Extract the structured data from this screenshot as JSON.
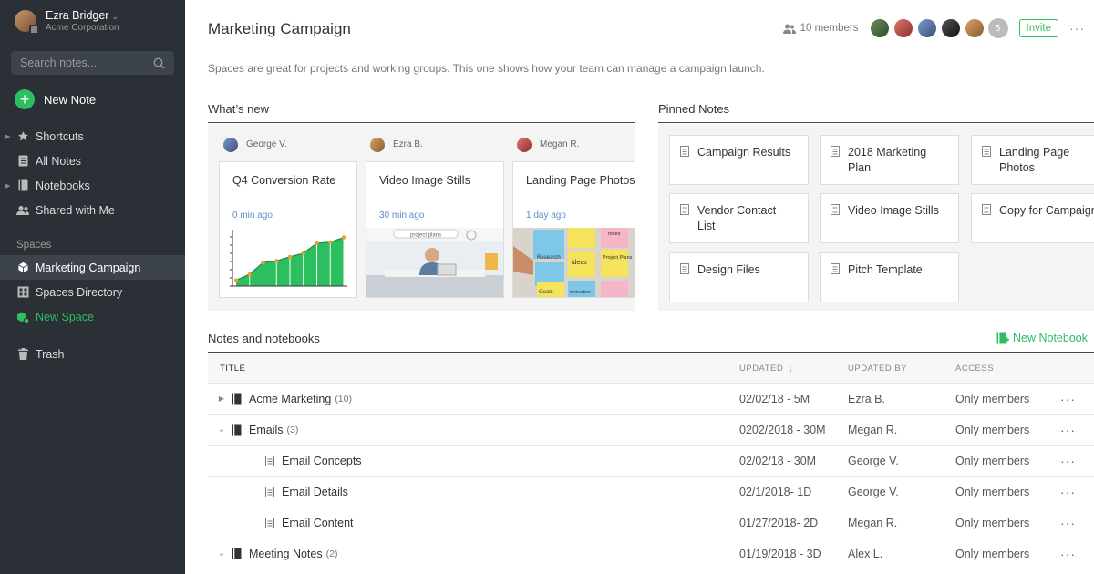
{
  "user": {
    "name": "Ezra Bridger",
    "org": "Acme Corporation"
  },
  "search": {
    "placeholder": "Search notes..."
  },
  "new_note": "New Note",
  "nav": {
    "shortcuts": "Shortcuts",
    "all_notes": "All Notes",
    "notebooks": "Notebooks",
    "shared": "Shared with Me"
  },
  "spaces": {
    "label": "Spaces",
    "campaign": "Marketing Campaign",
    "directory": "Spaces Directory",
    "new_space": "New Space"
  },
  "trash": "Trash",
  "colors": {
    "accent": "#2dbe60",
    "sidebar": "#2b3036",
    "link": "#5b8fc9"
  },
  "header": {
    "title": "Marketing Campaign",
    "members": "10 members",
    "extra_members": "5",
    "invite": "Invite",
    "description": "Spaces are great for projects and working groups. This one shows how your team can manage a campaign launch."
  },
  "whats_new": {
    "heading": "What’s new",
    "cards": [
      {
        "author": "George V.",
        "title": "Q4 Conversion Rate",
        "time": "0 min ago"
      },
      {
        "author": "Ezra B.",
        "title": "Video Image Stills",
        "time": "30 min ago",
        "thumb_text": "project plans"
      },
      {
        "author": "Megan R.",
        "title": "Landing Page Photos",
        "time": "1 day ago",
        "sticky_notes": [
          "Research",
          "ideas",
          "Project Plans",
          "Goals",
          "notes",
          "innovation"
        ]
      }
    ]
  },
  "conversion_chart": {
    "type": "area",
    "values": [
      1,
      2,
      4,
      4.3,
      5,
      5.6,
      7.3,
      7.5,
      8.3
    ]
  },
  "pinned": {
    "heading": "Pinned Notes",
    "notes": [
      "Campaign Results",
      "2018 Marketing Plan",
      "Landing Page Photos",
      "Vendor Contact List",
      "Video Image Stills",
      "Copy for Campaign",
      "Design Files",
      "Pitch Template"
    ]
  },
  "notebooks": {
    "heading": "Notes and notebooks",
    "new_notebook": "New Notebook",
    "columns": {
      "title": "TITLE",
      "updated": "UPDATED",
      "updated_by": "UPDATED BY",
      "access": "ACCESS"
    },
    "rows": [
      {
        "title": "Acme Marketing",
        "count": "(10)",
        "updated": "02/02/18 - 5M",
        "by": "Ezra B.",
        "access": "Only members"
      },
      {
        "title": "Emails",
        "count": "(3)",
        "updated": "0202/2018 - 30M",
        "by": "Megan R.",
        "access": "Only members"
      },
      {
        "title": "Email Concepts",
        "updated": "02/02/18 - 30M",
        "by": "George V.",
        "access": "Only members"
      },
      {
        "title": "Email Details",
        "updated": "02/1/2018- 1D",
        "by": "George V.",
        "access": "Only members"
      },
      {
        "title": "Email Content",
        "updated": "01/27/2018- 2D",
        "by": "Megan R.",
        "access": "Only members"
      },
      {
        "title": "Meeting Notes",
        "count": "(2)",
        "updated": "01/19/2018 - 3D",
        "by": "Alex L.",
        "access": "Only members"
      }
    ]
  }
}
